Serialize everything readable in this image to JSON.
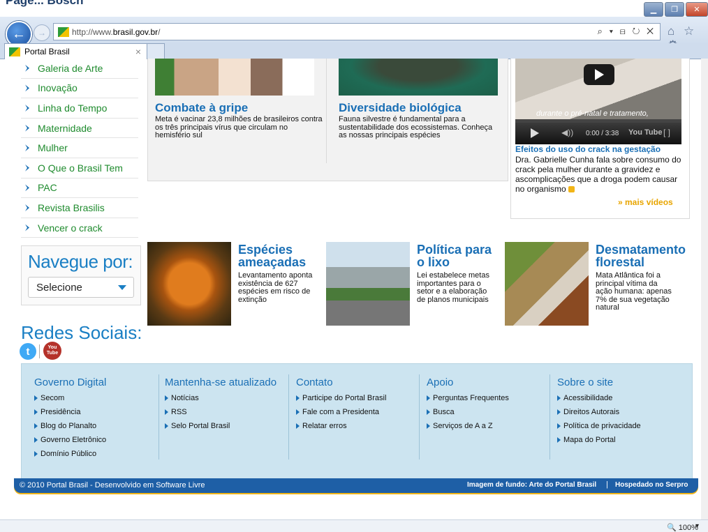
{
  "window": {
    "title_fragment": "Page... Bosch",
    "buttons": [
      "min",
      "restore",
      "close"
    ]
  },
  "browser": {
    "url_prefix": "http://www.",
    "url_domain": "brasil.gov.br",
    "url_suffix": "/",
    "address_tools": "⌕ ▾ ⊟ ↻ ✕",
    "right_icons": "⌂ ☆ ⚙",
    "tab": {
      "label": "Portal Brasil",
      "close": "×"
    }
  },
  "sidebar": {
    "items": [
      {
        "label": "Galeria de Arte"
      },
      {
        "label": "Inovação"
      },
      {
        "label": "Linha do Tempo"
      },
      {
        "label": "Maternidade"
      },
      {
        "label": "Mulher"
      },
      {
        "label": "O Que o Brasil Tem"
      },
      {
        "label": "PAC"
      },
      {
        "label": "Revista Brasilis"
      },
      {
        "label": "Vencer o crack"
      }
    ],
    "navegue": {
      "label": "Navegue por:",
      "selected": "Selecione"
    },
    "redes": {
      "label": "Redes Sociais:",
      "twitter": "t",
      "youtube_top": "You",
      "youtube_bottom": "Tube"
    }
  },
  "news": {
    "gripe": {
      "title": "Combate à gripe",
      "text": "Meta é vacinar 23,8 milhões de brasileiros contra os três principais vírus que circulam no hemisfério sul"
    },
    "bio": {
      "title": "Diversidade biológica",
      "text": "Fauna silvestre é fundamental para a sustentabilidade dos ecossistemas. Conheça as nossas principais espécies"
    }
  },
  "video": {
    "caption": "durante o pré-natal e tratamento,",
    "volume": "◀))",
    "time": "0:00 / 3:38",
    "yt_logo": "You Tube",
    "fullscreen": "[ ]",
    "title": "Efeitos do uso do crack na gestação",
    "description": "Dra. Gabrielle Cunha fala sobre consumo do crack pela mulher durante a gravidez e ascomplicações que a droga podem causar no organismo",
    "more": "» mais vídeos"
  },
  "features": [
    {
      "title": "Espécies ameaçadas",
      "text": "Levantamento aponta existência de 627 espécies em risco de extinção"
    },
    {
      "title": "Política para o lixo",
      "text": "Lei estabelece metas importantes para o setor e a elaboração de planos municipais"
    },
    {
      "title": "Desmatamento florestal",
      "text": "Mata Atlântica foi a principal vítima da ação humana: apenas 7% de sua vegetação natural"
    }
  ],
  "footer": {
    "columns": [
      {
        "heading": "Governo Digital",
        "links": [
          "Secom",
          "Presidência",
          "Blog do Planalto",
          "Governo Eletrônico",
          "Domínio Público"
        ]
      },
      {
        "heading": "Mantenha-se atualizado",
        "links": [
          "Notícias",
          "RSS",
          "Selo Portal Brasil"
        ]
      },
      {
        "heading": "Contato",
        "links": [
          "Participe do Portal Brasil",
          "Fale com a Presidenta",
          "Relatar erros"
        ]
      },
      {
        "heading": "Apoio",
        "links": [
          "Perguntas Frequentes",
          "Busca",
          "Serviços de A a Z"
        ]
      },
      {
        "heading": "Sobre o site",
        "links": [
          "Acessibilidade",
          "Direitos Autorais",
          "Política de privacidade",
          "Mapa do Portal"
        ]
      }
    ],
    "bar_left": "© 2010 Portal Brasil - Desenvolvido em Software Livre",
    "bar_right1": "Imagem de fundo: Arte do Portal Brasil",
    "bar_pipe": "|",
    "bar_right2": "Hospedado no Serpro"
  },
  "status": {
    "zoom": "🔍 100%",
    "zoom_caret": "▾"
  },
  "colors": {
    "accent_blue": "#1a6fb5",
    "green_link": "#1f8b2e",
    "footer_bg": "#cce4f0",
    "footer_bar": "#1e5fa6",
    "highlight": "#e8a500"
  }
}
